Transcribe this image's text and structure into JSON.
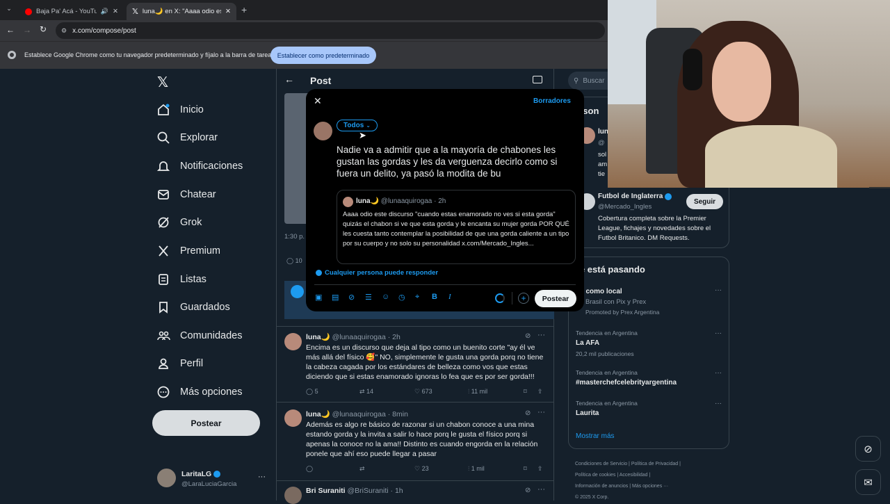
{
  "browser": {
    "tabs": [
      {
        "title": "Baja Pa' Acá - YouTube Mu"
      },
      {
        "title": "luna🌙 en X: \"Aaaa odio este d"
      }
    ],
    "url": "x.com/compose/post",
    "infobar_text": "Establece Google Chrome como tu navegador predeterminado y fíjalo a la barra de tareas",
    "infobar_button": "Establecer como predeterminado"
  },
  "sidebar": {
    "items": [
      {
        "label": "Inicio"
      },
      {
        "label": "Explorar"
      },
      {
        "label": "Notificaciones"
      },
      {
        "label": "Chatear"
      },
      {
        "label": "Grok"
      },
      {
        "label": "Premium"
      },
      {
        "label": "Listas"
      },
      {
        "label": "Guardados"
      },
      {
        "label": "Comunidades"
      },
      {
        "label": "Perfil"
      },
      {
        "label": "Más opciones"
      }
    ],
    "post_button": "Postear",
    "account": {
      "name": "LaritaLG",
      "handle": "@LaraLuciaGarcia"
    }
  },
  "header": {
    "title": "Post"
  },
  "background": {
    "time": "1:30 p.",
    "count": "10"
  },
  "compose": {
    "drafts": "Borradores",
    "audience": "Todos",
    "text": "Nadie va a admitir que a la mayoría de chabones les gustan las gordas y les da verguenza decirlo como si fuera un delito, ya pasó la modita de bu",
    "quote": {
      "name": "luna🌙",
      "handle": "@lunaaquirogaa",
      "time": "· 2h",
      "text": "Aaaa odio este discurso \"cuando estas enamorado no ves si esta gorda\" quizás el chabon si ve que esta gorda y le encanta su mujer gorda POR QUÉ les cuesta tanto contemplar la posibilidad de que una gorda caliente a un tipo por su cuerpo y no solo su personalidad x.com/Mercado_Ingles..."
    },
    "reply_setting": "Cualquier persona puede responder",
    "post_button": "Postear"
  },
  "replies": [
    {
      "name": "luna🌙",
      "handle": "@lunaaquirogaa",
      "time": "· 2h",
      "text": "Encima es un discurso que deja al tipo como un buenito corte \"ay él ve más allá del físico 🥰\" NO, simplemente le gusta una gorda porq no tiene la cabeza cagada por los estándares de belleza como vos que estas diciendo que si estas enamorado ignoras lo fea que es por ser gorda!!!",
      "replies": "5",
      "reposts": "14",
      "likes": "673",
      "views": "11 mil"
    },
    {
      "name": "luna🌙",
      "handle": "@lunaaquirogaa",
      "time": "· 8min",
      "text": "Además es algo re básico de razonar si un chabon conoce a una mina estando gorda y la invita a salir lo hace porq le gusta el físico porq si apenas la conoce no la ama!! Distinto es cuando engorda en la relación ponele que ahí eso puede llegar a pasar",
      "replies": "",
      "reposts": "",
      "likes": "23",
      "views": "1 mil"
    },
    {
      "name": "Bri Suraniti",
      "handle": "@BriSuraniti",
      "time": "· 1h"
    }
  ],
  "right": {
    "search_placeholder": "Buscar",
    "section_title": "erson",
    "who1": {
      "name": "lun",
      "line1": "@",
      "line2": "sol",
      "line3": "am",
      "line4": "tie"
    },
    "who2": {
      "name": "Futbol de Inglaterra",
      "handle": "@Mercado_Ingles",
      "follow": "Seguir",
      "bio": "Cobertura completa sobre la Premier League, fichajes y novedades sobre el Futbol Britanico. DM Requests."
    },
    "trends_title": "ué está pasando",
    "trends": [
      {
        "meta": "",
        "title": "gá como local",
        "sub": "Brasil con Pix y Prex",
        "promo": "Promoted by Prex Argentina"
      },
      {
        "meta": "Tendencia en Argentina",
        "title": "La AFA",
        "sub": "20,2 mil publicaciones",
        "promo": ""
      },
      {
        "meta": "Tendencia en Argentina",
        "title": "#masterchefcelebrityargentina",
        "sub": "",
        "promo": ""
      },
      {
        "meta": "Tendencia en Argentina",
        "title": "Laurita",
        "sub": "",
        "promo": ""
      }
    ],
    "show_more": "Mostrar más",
    "footer": [
      "Condiciones de Servicio",
      "Política de Privacidad",
      "Política de cookies",
      "Accesibilidad",
      "Información de anuncios",
      "Más opciones ···",
      "© 2025 X Corp."
    ]
  },
  "colors": {
    "accent": "#1d9bf0",
    "bg": "#15202b",
    "modal": "#000000"
  }
}
